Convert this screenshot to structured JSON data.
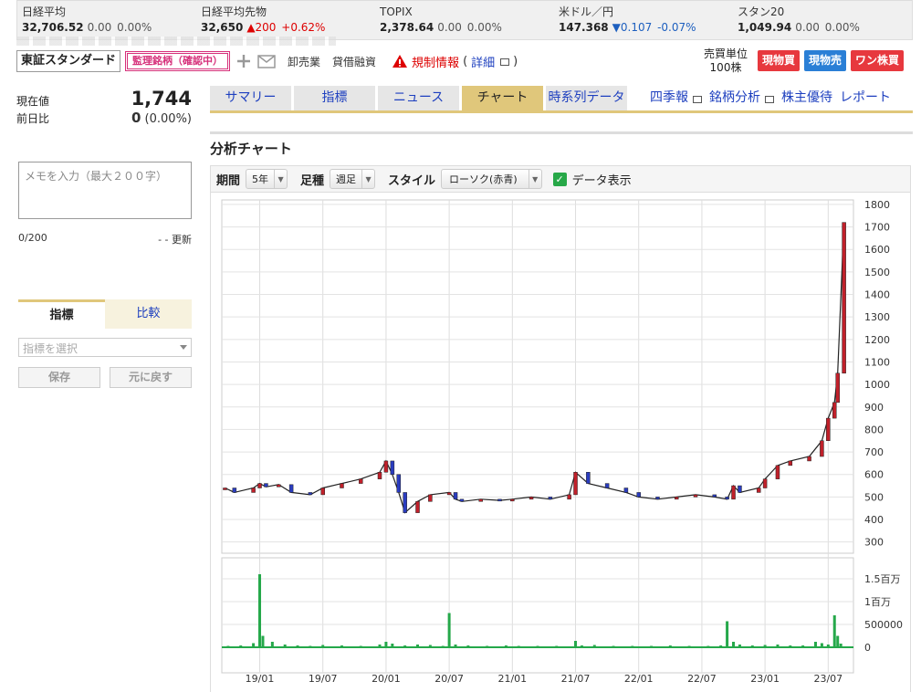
{
  "ticker": [
    {
      "name": "日経平均",
      "value": "32,706.52",
      "change": "0.00",
      "pct": "0.00%",
      "dir": "flat"
    },
    {
      "name": "日経平均先物",
      "value": "32,650",
      "change": "▲200",
      "pct": "+0.62%",
      "dir": "up"
    },
    {
      "name": "TOPIX",
      "value": "2,378.64",
      "change": "0.00",
      "pct": "0.00%",
      "dir": "flat"
    },
    {
      "name": "米ドル／円",
      "value": "147.368",
      "change": "▼0.107",
      "pct": "-0.07%",
      "dir": "down"
    },
    {
      "name": "スタン20",
      "value": "1,049.94",
      "change": "0.00",
      "pct": "0.00%",
      "dir": "flat"
    }
  ],
  "header": {
    "market": "東証スタンダード",
    "warning_badge": "監理銘柄（確認中）",
    "links": [
      "卸売業",
      "貸借融資"
    ],
    "regulation": "規制情報",
    "regulation_paren_open": "(",
    "regulation_detail": "詳細",
    "regulation_paren_close": ")",
    "unit_label": "売買単位",
    "unit_value": "100株",
    "trade_buttons": [
      {
        "label": "現物買",
        "color": "#e7383e"
      },
      {
        "label": "現物売",
        "color": "#2a7fd6"
      },
      {
        "label": "ワン株買",
        "color": "#e7383e"
      }
    ]
  },
  "left": {
    "price_label": "現在値",
    "price": "1,744",
    "change_label": "前日比",
    "change": "0",
    "change_pct": "(0.00%)",
    "memo_placeholder": "メモを入力（最大２００字）",
    "memo_count": "0/200",
    "memo_update": "- - 更新",
    "tabs": [
      "指標",
      "比較"
    ],
    "indicator_placeholder": "指標を選択",
    "save": "保存",
    "reset": "元に戻す"
  },
  "tabs": [
    "サマリー",
    "指標",
    "ニュース",
    "チャート",
    "時系列データ"
  ],
  "active_tab": "チャート",
  "tab_links": [
    "四季報",
    "銘柄分析",
    "株主優待",
    "レポート"
  ],
  "chart_title": "分析チャート",
  "controls": {
    "period_label": "期間",
    "period_value": "5年",
    "foot_label": "足種",
    "foot_value": "週足",
    "style_label": "スタイル",
    "style_value": "ローソク(赤青)",
    "data_display": "データ表示",
    "data_display_checked": true
  },
  "chart_data": {
    "type": "line",
    "x_ticks": [
      "19/01",
      "19/07",
      "20/01",
      "20/07",
      "21/01",
      "21/07",
      "22/01",
      "22/07",
      "23/01",
      "23/07"
    ],
    "y_ticks": [
      300,
      400,
      500,
      600,
      700,
      800,
      900,
      1000,
      1100,
      1200,
      1300,
      1400,
      1500,
      1600,
      1700,
      1800
    ],
    "ylim": [
      250,
      1820
    ],
    "volume_ticks": [
      "1.5百万",
      "1百万",
      "500000",
      "0"
    ],
    "volume_tick_values": [
      1500000,
      1000000,
      500000,
      0
    ],
    "volume_ylim": [
      0,
      1800000
    ],
    "x_range": [
      -0.6,
      9.4
    ],
    "price_series": {
      "name": "",
      "x": [
        -0.55,
        -0.4,
        -0.1,
        0.0,
        0.1,
        0.3,
        0.5,
        0.8,
        1.0,
        1.3,
        1.6,
        1.9,
        2.0,
        2.1,
        2.2,
        2.3,
        2.5,
        2.7,
        3.0,
        3.1,
        3.2,
        3.5,
        3.8,
        4.0,
        4.3,
        4.6,
        4.9,
        5.0,
        5.2,
        5.5,
        5.8,
        6.0,
        6.3,
        6.6,
        6.9,
        7.2,
        7.4,
        7.5,
        7.6,
        7.9,
        8.0,
        8.2,
        8.4,
        8.7,
        8.9,
        9.0,
        9.1,
        9.15,
        9.25
      ],
      "y": [
        540,
        520,
        540,
        560,
        545,
        555,
        520,
        510,
        540,
        560,
        580,
        610,
        660,
        600,
        520,
        430,
        480,
        510,
        520,
        490,
        480,
        490,
        485,
        490,
        500,
        490,
        510,
        610,
        560,
        540,
        520,
        500,
        490,
        500,
        510,
        500,
        490,
        550,
        520,
        540,
        580,
        640,
        660,
        680,
        750,
        850,
        920,
        1050,
        1720
      ]
    },
    "volume": {
      "name": "",
      "x": [
        -0.5,
        -0.3,
        -0.1,
        0.0,
        0.05,
        0.2,
        0.4,
        0.6,
        0.8,
        1.0,
        1.3,
        1.6,
        1.9,
        2.0,
        2.1,
        2.3,
        2.5,
        2.7,
        2.9,
        3.0,
        3.1,
        3.3,
        3.6,
        3.9,
        4.1,
        4.4,
        4.7,
        5.0,
        5.1,
        5.3,
        5.6,
        5.9,
        6.2,
        6.5,
        6.8,
        7.1,
        7.3,
        7.4,
        7.5,
        7.6,
        7.8,
        8.0,
        8.2,
        8.4,
        8.6,
        8.8,
        8.9,
        9.0,
        9.1,
        9.15,
        9.2
      ],
      "values": [
        30000,
        40000,
        90000,
        1600000,
        250000,
        120000,
        60000,
        40000,
        30000,
        50000,
        40000,
        30000,
        60000,
        120000,
        80000,
        40000,
        60000,
        50000,
        30000,
        750000,
        60000,
        40000,
        30000,
        40000,
        30000,
        30000,
        30000,
        140000,
        40000,
        50000,
        30000,
        30000,
        30000,
        40000,
        30000,
        30000,
        40000,
        570000,
        120000,
        60000,
        40000,
        50000,
        60000,
        40000,
        40000,
        120000,
        90000,
        60000,
        700000,
        250000,
        80000
      ]
    }
  }
}
